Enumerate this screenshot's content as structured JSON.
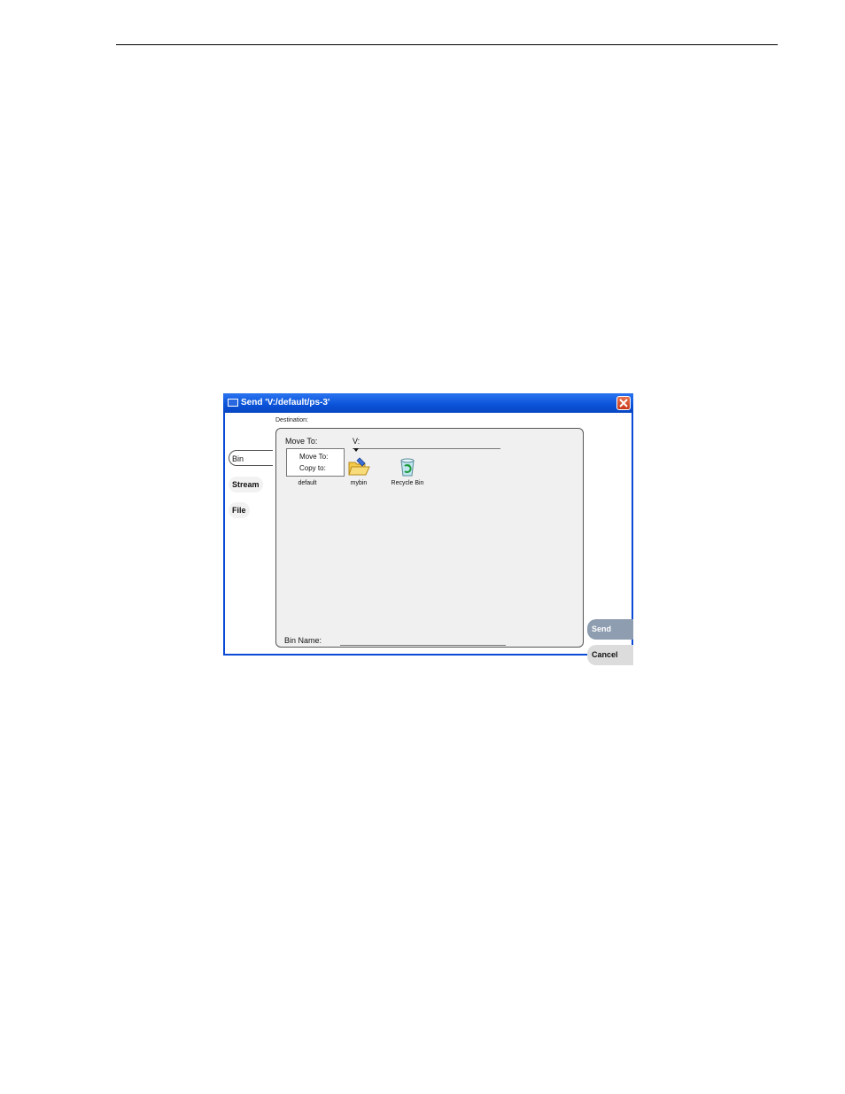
{
  "dialog": {
    "title": "Send 'V:/default/ps-3'",
    "destination_label": "Destination:"
  },
  "tabs": {
    "bin": "Bin",
    "stream": "Stream",
    "file": "File"
  },
  "move": {
    "label": "Move To:",
    "path": "V:",
    "menu": [
      "Move To:",
      "Copy to:"
    ]
  },
  "bins": [
    {
      "label": "default",
      "icon": "folder-icon"
    },
    {
      "label": "mybin",
      "icon": "open-folder-icon"
    },
    {
      "label": "Recycle Bin",
      "icon": "recycle-bin-icon"
    }
  ],
  "bin_name": {
    "label": "Bin Name:",
    "value": ""
  },
  "buttons": {
    "send": "Send",
    "cancel": "Cancel"
  },
  "colors": {
    "window_frame": "#0a4ad6",
    "send_button": "#8e9db0",
    "close_button": "#c9391a"
  }
}
